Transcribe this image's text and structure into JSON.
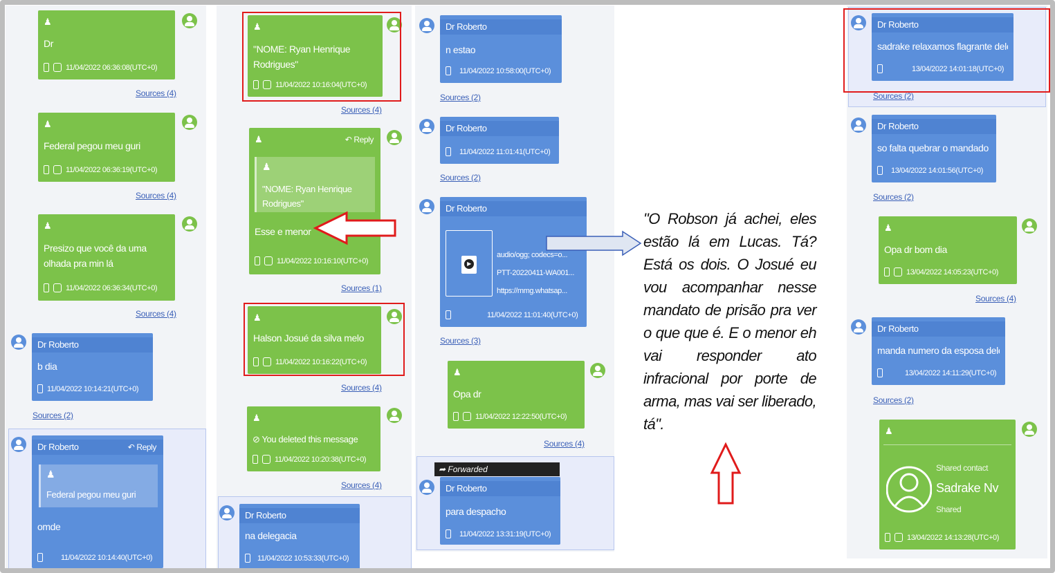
{
  "col1": {
    "m1": {
      "text": "Dr",
      "ts": "11/04/2022 06:36:08(UTC+0)",
      "sources": "Sources (4)"
    },
    "m2": {
      "text": "Federal pegou meu guri",
      "ts": "11/04/2022 06:36:19(UTC+0)",
      "sources": "Sources (4)"
    },
    "m3": {
      "text": "Presizo que você da uma olhada pra min lá",
      "ts": "11/04/2022 06:36:34(UTC+0)",
      "sources": "Sources (4)"
    },
    "m4": {
      "sender": "Dr Roberto",
      "text": "b dia",
      "ts": "11/04/2022 10:14:21(UTC+0)",
      "sources": "Sources (2)"
    },
    "m5": {
      "sender": "Dr Roberto",
      "reply": "Reply",
      "quote": "Federal pegou meu guri",
      "text": "omde",
      "ts": "11/04/2022 10:14:40(UTC+0)"
    }
  },
  "col2": {
    "m1": {
      "text": "\"NOME: Ryan Henrique Rodrigues\"",
      "ts": "11/04/2022 10:16:04(UTC+0)",
      "sources": "Sources (4)"
    },
    "m2": {
      "reply": "Reply",
      "quote": "\"NOME: Ryan Henrique Rodrigues\"",
      "text": "Esse e menor",
      "ts": "11/04/2022 10:16:10(UTC+0)",
      "sources": "Sources (1)"
    },
    "m3": {
      "text": "Halson Josué da silva melo",
      "ts": "11/04/2022 10:16:22(UTC+0)",
      "sources": "Sources (4)"
    },
    "m4": {
      "text": "You deleted this message",
      "ts": "11/04/2022 10:20:38(UTC+0)",
      "sources": "Sources (4)"
    },
    "m5": {
      "sender": "Dr Roberto",
      "text": "na delegacia",
      "ts": "11/04/2022 10:53:33(UTC+0)"
    }
  },
  "col3": {
    "m1": {
      "sender": "Dr Roberto",
      "text": "n estao",
      "ts": "11/04/2022 10:58:00(UTC+0)",
      "sources": "Sources (2)"
    },
    "m2": {
      "sender": "Dr Roberto",
      "ts": "11/04/2022 11:01:41(UTC+0)",
      "sources": "Sources (2)"
    },
    "m3": {
      "sender": "Dr Roberto",
      "att1": "audio/ogg; codecs=o...",
      "att2": "PTT-20220411-WA001...",
      "att3": "https://mmg.whatsap...",
      "ts": "11/04/2022 11:01:40(UTC+0)",
      "sources": "Sources (3)"
    },
    "m4": {
      "text": "Opa dr",
      "ts": "11/04/2022 12:22:50(UTC+0)",
      "sources": "Sources (4)"
    },
    "m5": {
      "forwarded": "Forwarded",
      "sender": "Dr Roberto",
      "text": "para despacho",
      "ts": "11/04/2022 13:31:19(UTC+0)"
    }
  },
  "caption": "\"O Robson já achei, eles estão lá em Lucas. Tá? Está os dois. O Josué eu vou acompanhar nesse mandato de prisão pra ver o que que é. E o menor eh vai responder ato infracional por porte de arma, mas vai ser liberado, tá\".",
  "col5": {
    "m1": {
      "sender": "Dr Roberto",
      "text": "sadrake relaxamos flagrante dele",
      "ts": "13/04/2022 14:01:18(UTC+0)",
      "sources": "Sources (2)"
    },
    "m2": {
      "sender": "Dr Roberto",
      "text": "so falta quebrar o mandado",
      "ts": "13/04/2022 14:01:56(UTC+0)",
      "sources": "Sources (2)"
    },
    "m3": {
      "text": "Opa dr bom dia",
      "ts": "13/04/2022 14:05:23(UTC+0)",
      "sources": "Sources (4)"
    },
    "m4": {
      "sender": "Dr Roberto",
      "text": "manda numero da esposa dele",
      "ts": "13/04/2022 14:11:29(UTC+0)",
      "sources": "Sources (2)"
    },
    "m5": {
      "label": "Shared contact",
      "name": "Sadrake Nv",
      "sub": "Shared",
      "ts": "13/04/2022 14:13:28(UTC+0)"
    }
  },
  "colors": {
    "green": "#7cc24a",
    "blue": "#5b8fdb",
    "highlight": "#e01b1b"
  },
  "icons": [
    "person-icon",
    "phone-icon",
    "save-icon",
    "reply-icon",
    "forward-icon",
    "play-icon",
    "avatar-icon",
    "block-icon",
    "arrow-left-icon",
    "arrow-right-icon",
    "arrow-up-icon"
  ]
}
